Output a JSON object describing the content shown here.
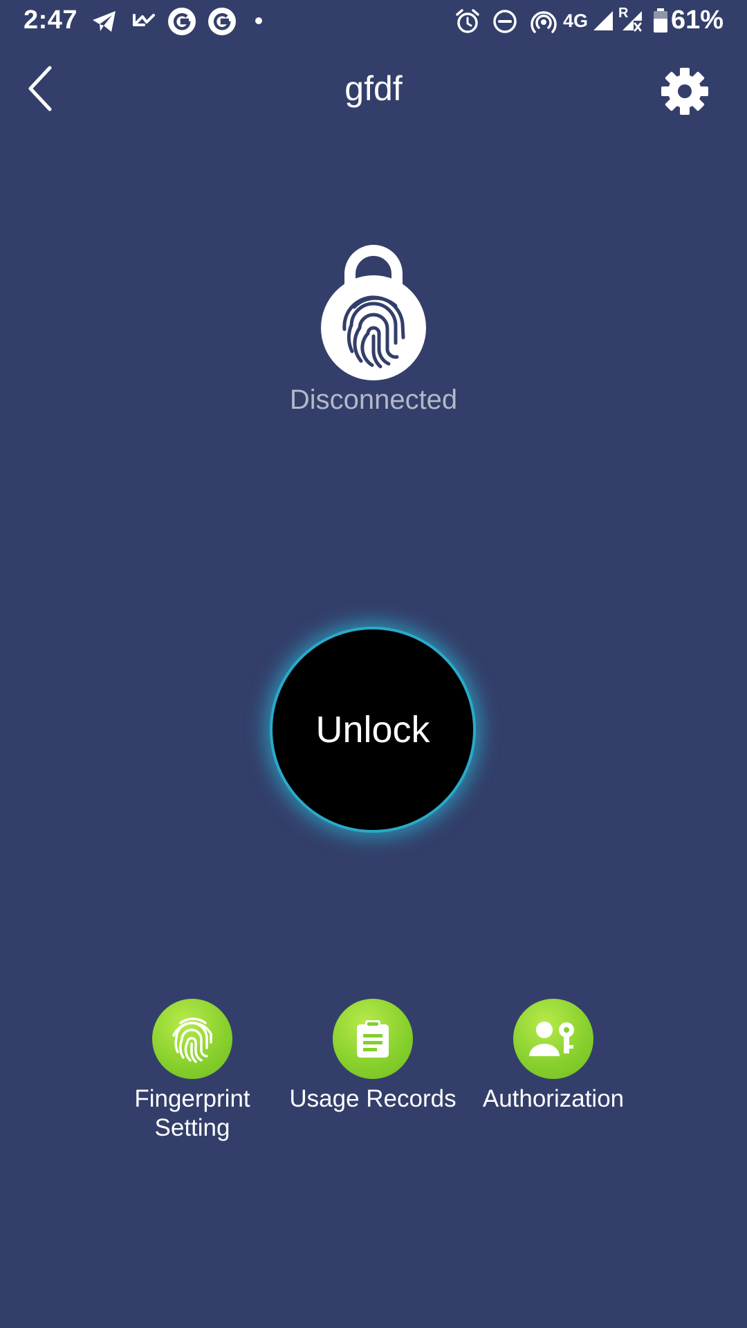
{
  "status_bar": {
    "time": "2:47",
    "network": "4G",
    "roaming": "R",
    "battery": "61%",
    "icons": [
      "telegram-icon",
      "missed-call-icon",
      "google-icon",
      "google-icon",
      "dot-icon",
      "alarm-icon",
      "do-not-disturb-icon",
      "hotspot-icon",
      "signal-icon",
      "signal-roaming-icon",
      "battery-icon"
    ]
  },
  "header": {
    "title": "gfdf",
    "back_icon": "chevron-left-icon",
    "settings_icon": "gear-icon"
  },
  "lock": {
    "icon": "padlock-fingerprint-icon",
    "status": "Disconnected"
  },
  "unlock": {
    "label": "Unlock",
    "glow_color": "#2aaac8"
  },
  "actions": [
    {
      "label": "Fingerprint\nSetting",
      "icon": "fingerprint-icon"
    },
    {
      "label": "Usage Records",
      "icon": "clipboard-icon"
    },
    {
      "label": "Authorization",
      "icon": "user-key-icon"
    }
  ],
  "colors": {
    "background": "#333f6a",
    "accent_green": "#86cf2c",
    "status_text": "#b3b8c9"
  }
}
